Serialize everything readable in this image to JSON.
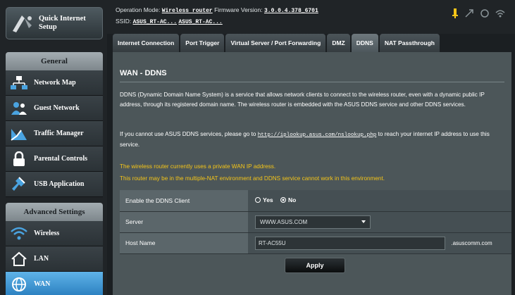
{
  "sidebar": {
    "quick_setup": "Quick Internet Setup",
    "general_title": "General",
    "general_items": [
      {
        "label": "Network Map",
        "icon": "network-map-icon"
      },
      {
        "label": "Guest Network",
        "icon": "guest-network-icon"
      },
      {
        "label": "Traffic Manager",
        "icon": "traffic-manager-icon"
      },
      {
        "label": "Parental Controls",
        "icon": "parental-controls-icon"
      },
      {
        "label": "USB Application",
        "icon": "usb-application-icon"
      }
    ],
    "advanced_title": "Advanced Settings",
    "advanced_items": [
      {
        "label": "Wireless",
        "icon": "wireless-icon"
      },
      {
        "label": "LAN",
        "icon": "lan-icon"
      },
      {
        "label": "WAN",
        "icon": "wan-icon",
        "active": true
      }
    ]
  },
  "header": {
    "operation_mode_label": "Operation Mode:",
    "operation_mode_value": "Wireless router",
    "firmware_label": "Firmware Version:",
    "firmware_value": "3.0.0.4.378_6701",
    "ssid_label": "SSID:",
    "ssid_1": "ASUS_RT-AC...",
    "ssid_2": "ASUS_RT-AC..."
  },
  "tabs": [
    {
      "label": "Internet Connection"
    },
    {
      "label": "Port Trigger"
    },
    {
      "label": "Virtual Server / Port Forwarding"
    },
    {
      "label": "DMZ"
    },
    {
      "label": "DDNS",
      "active": true
    },
    {
      "label": "NAT Passthrough"
    }
  ],
  "main": {
    "title": "WAN - DDNS",
    "description": "DDNS (Dynamic Domain Name System) is a service that allows network clients to connect to the wireless router, even with a dynamic public IP address, through its registered domain name. The wireless router is embedded with the ASUS DDNS service and other DDNS services.",
    "note_prefix": "If you cannot use ASUS DDNS services, please go to",
    "note_link": "http://iplookup.asus.com/nslookup.php",
    "note_suffix": "to reach your internet IP address to use this service.",
    "warning_1": "The wireless router currently uses a private WAN IP address.",
    "warning_2": "This router may be in the multiple-NAT environment and DDNS service cannot work in this environment.",
    "form": {
      "enable_label": "Enable the DDNS Client",
      "yes_label": "Yes",
      "no_label": "No",
      "server_label": "Server",
      "server_value": "WWW.ASUS.COM",
      "hostname_label": "Host Name",
      "hostname_value": "RT-AC55U",
      "hostname_suffix": ".asuscomm.com"
    },
    "apply_label": "Apply"
  },
  "colors": {
    "accent_blue": "#2a7fbf",
    "warning_yellow": "#f5c518",
    "panel_bg": "#4c5659"
  }
}
